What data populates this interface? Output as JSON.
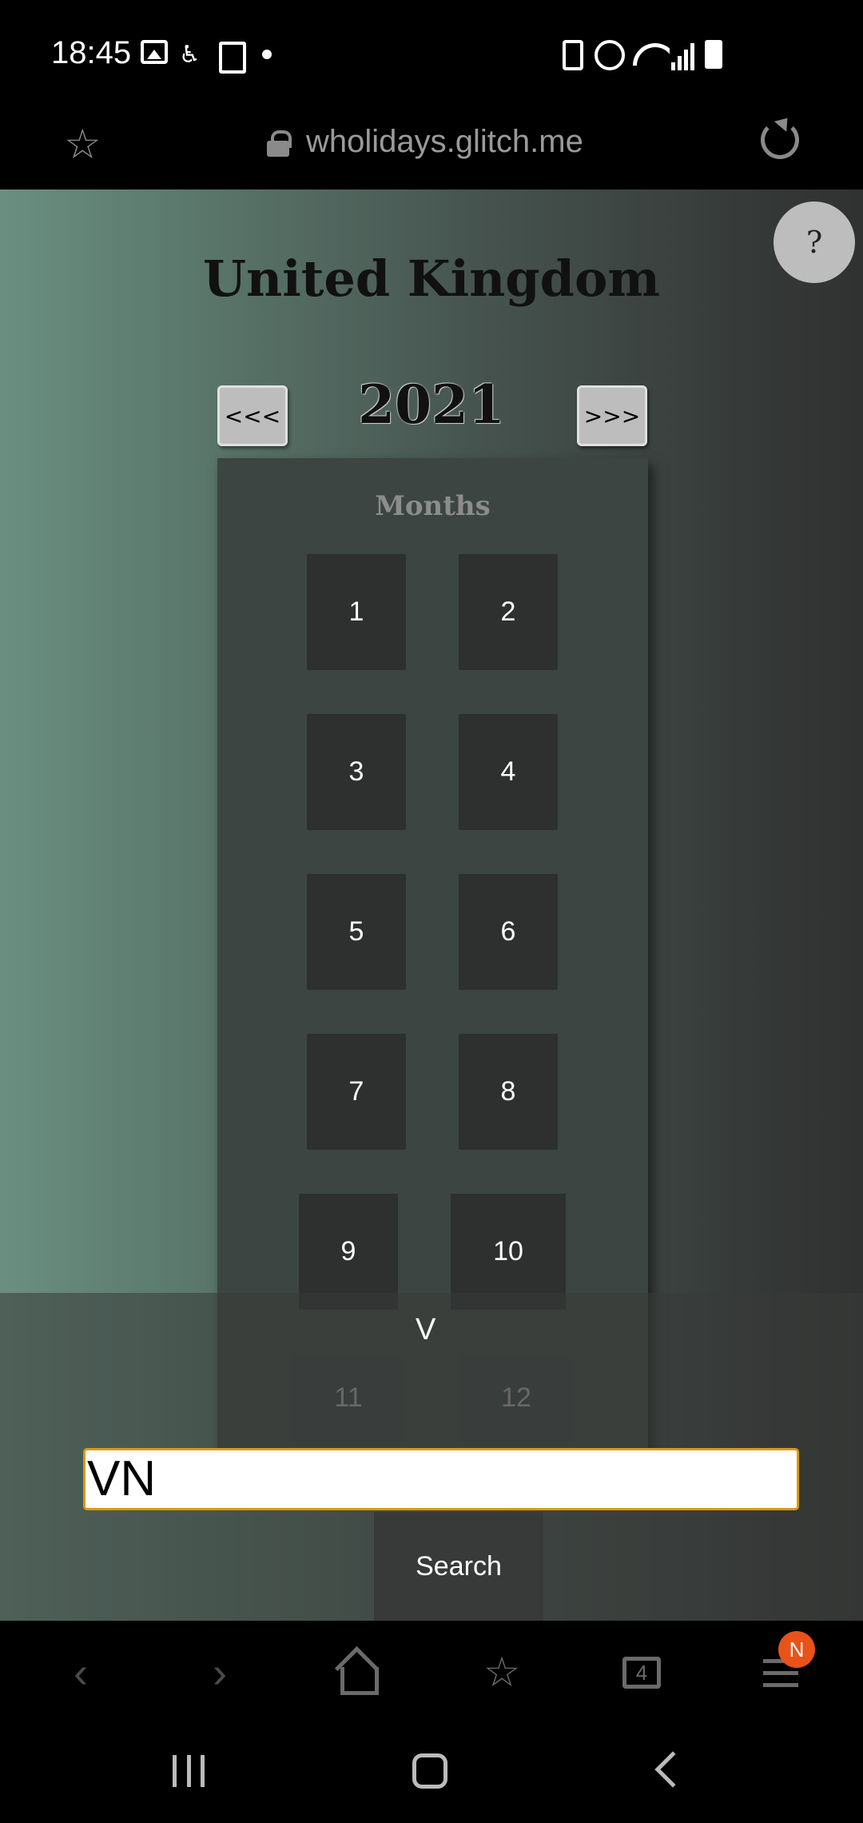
{
  "status_bar": {
    "time": "18:45"
  },
  "url_bar": {
    "url": "wholidays.glitch.me"
  },
  "page": {
    "help_label": "?",
    "country_title": "United Kingdom",
    "year": "2021",
    "prev_year_label": "<<<",
    "next_year_label": ">>>",
    "months_heading": "Months",
    "months": [
      "1",
      "2",
      "3",
      "4",
      "5",
      "6",
      "7",
      "8",
      "9",
      "10",
      "11",
      "12"
    ],
    "expand_label": "V",
    "search_value": "VN",
    "search_button_label": "Search"
  },
  "toolbar": {
    "tabs_count": "4",
    "menu_badge": "N"
  },
  "colors": {
    "accent_border": "#d89a10",
    "badge": "#e8531a"
  }
}
